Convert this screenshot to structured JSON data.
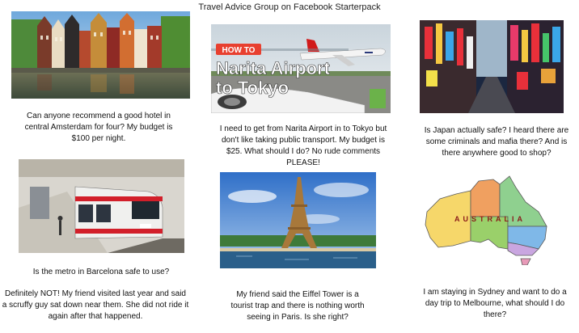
{
  "title": "Travel Advice Group on Facebook Starterpack",
  "panels": {
    "amsterdam": {
      "caption": "Can anyone recommend a good hotel in central Amsterdam for four? My budget is $100 per night."
    },
    "narita": {
      "banner_top": "HOW TO",
      "banner_line1": "Narita Airport",
      "banner_line2": "to Tokyo",
      "caption": "I need to get from Narita Airport in to Tokyo but don't like taking public transport. My budget is $25. What should I do? No rude comments PLEASE!"
    },
    "japan": {
      "caption": "Is Japan actually safe? I heard there are some criminals and mafia there? And is there anywhere good to shop?"
    },
    "barcelona": {
      "caption": "Is the metro in Barcelona safe to use?",
      "reply": "Definitely NOT! My friend visited last year and said a scruffy guy sat down near them. She did not ride it again after that happened."
    },
    "paris": {
      "caption": "My friend said the Eiffel Tower is a tourist trap and there is nothing worth seeing in Paris. Is she right?"
    },
    "australia": {
      "map_label": "AUSTRALIA",
      "caption": "I am staying in Sydney and want to do a day trip to Melbourne, what should I do there?"
    }
  }
}
